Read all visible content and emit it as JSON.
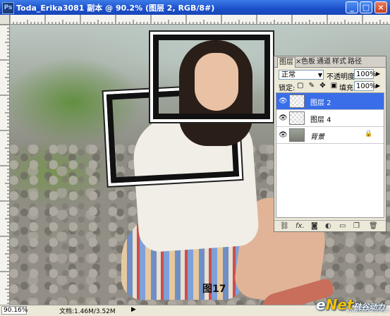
{
  "window": {
    "title": "Toda_Erika3081 副本 @ 90.2% (图层 2, RGB/8#)",
    "app_icon": "Ps",
    "minimize_symbol": "_",
    "maximize_symbol": "□",
    "close_symbol": "×"
  },
  "canvas": {
    "figure_label": "图17"
  },
  "layers_panel": {
    "tabs": [
      {
        "label": "图层"
      },
      {
        "label": "色板"
      },
      {
        "label": "通道"
      },
      {
        "label": "样式"
      },
      {
        "label": "路径"
      }
    ],
    "tab_close": "×",
    "blend_mode": "正常",
    "opacity_label": "不透明度:",
    "opacity_value": "100%",
    "lock_label": "锁定:",
    "fill_label": "填充:",
    "fill_value": "100%",
    "layers": [
      {
        "name": "图层 2",
        "selected": true
      },
      {
        "name": "图层 4",
        "selected": false
      },
      {
        "name": "背景",
        "selected": false,
        "locked": true
      }
    ],
    "footer_icons": [
      "link-icon",
      "fx-icon",
      "mask-icon",
      "adjustment-icon",
      "folder-icon",
      "new-layer-icon",
      "trash-icon"
    ],
    "footer_fx": "fx."
  },
  "status": {
    "zoom": "90.16%",
    "doc_info": "文档:1.46M/3.52M"
  },
  "watermark": {
    "brand_e": "e",
    "brand_net": "Net",
    "brand_cn": "硅谷动力",
    "sub": "www.enet.com.cn"
  }
}
